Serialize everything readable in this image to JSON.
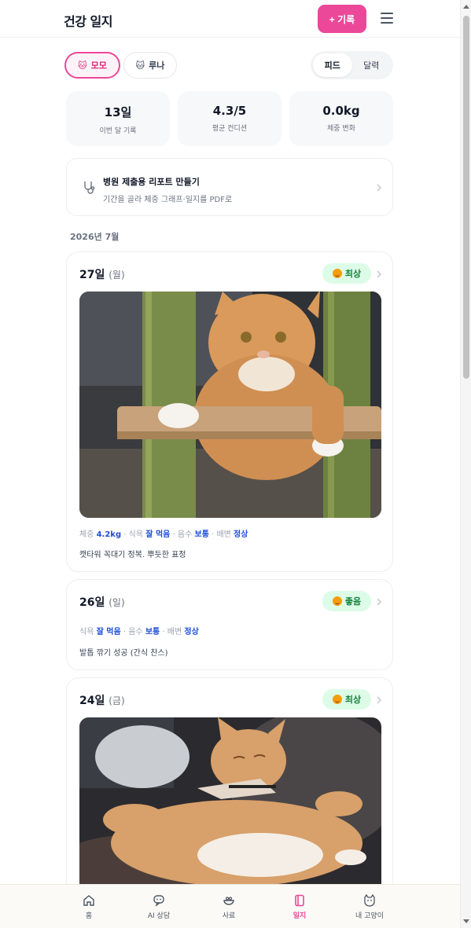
{
  "header": {
    "title": "건강 일지",
    "add_label": "+ 기록"
  },
  "cats": [
    {
      "name": "모모",
      "emoji": "🐱"
    },
    {
      "name": "루나",
      "emoji": "🐱"
    }
  ],
  "view_toggle": {
    "feed": "피드",
    "calendar": "달력",
    "selected": "feed"
  },
  "stats": [
    {
      "value": "13일",
      "label": "이번 달 기록"
    },
    {
      "value": "4.3/5",
      "label": "평균 컨디션"
    },
    {
      "value": "0.0kg",
      "label": "체중 변화"
    }
  ],
  "report": {
    "title": "병원 제출용 리포트 만들기",
    "subtitle": "기간을 골라 체중 그래프·일지를 PDF로"
  },
  "month_label": "2026년 7월",
  "entries": [
    {
      "date": "27일",
      "dow": "(월)",
      "mood": "최상",
      "metrics": [
        {
          "label": "체중",
          "value": "4.2kg"
        },
        {
          "label": "식욕",
          "value": "잘 먹음"
        },
        {
          "label": "음수",
          "value": "보통"
        },
        {
          "label": "배변",
          "value": "정상"
        }
      ],
      "note": "캣타워 꼭대기 정복. 뿌듯한 표정"
    },
    {
      "date": "26일",
      "dow": "(일)",
      "mood": "좋음",
      "metrics": [
        {
          "label": "식욕",
          "value": "잘 먹음"
        },
        {
          "label": "음수",
          "value": "보통"
        },
        {
          "label": "배변",
          "value": "정상"
        }
      ],
      "note": "발톱 깎기 성공 (간식 찬스)"
    },
    {
      "date": "24일",
      "dow": "(금)",
      "mood": "최상",
      "metrics": [],
      "note": ""
    }
  ],
  "nav": [
    {
      "label": "홈",
      "icon": "home-icon"
    },
    {
      "label": "AI 상담",
      "icon": "chat-icon"
    },
    {
      "label": "사료",
      "icon": "food-bowl-icon"
    },
    {
      "label": "일지",
      "icon": "journal-icon",
      "active": true
    },
    {
      "label": "내 고양이",
      "icon": "cat-face-icon"
    }
  ],
  "colors": {
    "accent": "#ec4899",
    "mood_badge_bg": "#dcfce7",
    "mood_badge_text": "#15803d",
    "metric_value": "#1d4ed8"
  }
}
